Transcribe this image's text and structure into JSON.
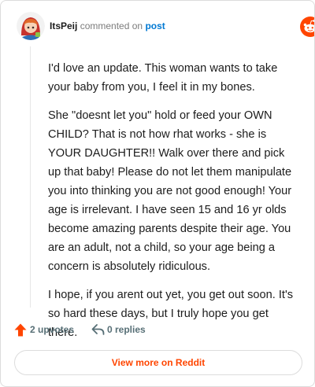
{
  "header": {
    "username": "ItsPeij",
    "verb": "commented on",
    "post_link": "post",
    "brand": "reddit"
  },
  "comment": {
    "paragraphs": [
      "I'd love an update. This woman wants to take your baby from you, I feel it in my bones.",
      "She \"doesnt let you\" hold or feed your OWN CHILD? That is not how rhat works - she is YOUR DAUGHTER!! Walk over there and pick up that baby! Please do not let them manipulate you into thinking you are not good enough! Your age is irrelevant. I have seen 15 and 16 yr olds become amazing parents despite their age. You are an adult, not a child, so your age being a concern is absolutely ridiculous.",
      "I hope, if you arent out yet, you get out soon. It's so hard these days, but I truly hope you get there."
    ]
  },
  "actions": {
    "upvotes_label": "2 upvotes",
    "replies_label": "0 replies"
  },
  "footer": {
    "view_more_label": "View more on Reddit"
  },
  "colors": {
    "brand": "#ff4500",
    "link": "#0079d3",
    "muted": "#576f76"
  },
  "icons": {
    "upvote": "upvote-arrow-icon",
    "reply": "reply-arrow-icon",
    "logo": "reddit-snoo-icon"
  }
}
